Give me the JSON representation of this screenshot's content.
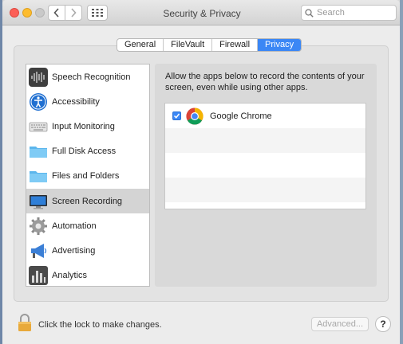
{
  "window": {
    "title": "Security & Privacy",
    "search_placeholder": "Search"
  },
  "tabs": [
    {
      "label": "General",
      "active": false
    },
    {
      "label": "FileVault",
      "active": false
    },
    {
      "label": "Firewall",
      "active": false
    },
    {
      "label": "Privacy",
      "active": true
    }
  ],
  "sidebar": {
    "items": [
      {
        "label": "Speech Recognition",
        "icon": "waveform-icon"
      },
      {
        "label": "Accessibility",
        "icon": "accessibility-icon"
      },
      {
        "label": "Input Monitoring",
        "icon": "keyboard-icon"
      },
      {
        "label": "Full Disk Access",
        "icon": "folder-icon"
      },
      {
        "label": "Files and Folders",
        "icon": "folder-icon"
      },
      {
        "label": "Screen Recording",
        "icon": "display-icon",
        "selected": true
      },
      {
        "label": "Automation",
        "icon": "gear-icon"
      },
      {
        "label": "Advertising",
        "icon": "megaphone-icon"
      },
      {
        "label": "Analytics",
        "icon": "bar-chart-icon"
      }
    ]
  },
  "content": {
    "instructions": "Allow the apps below to record the contents of your screen, even while using other apps.",
    "apps": [
      {
        "name": "Google Chrome",
        "checked": true,
        "icon": "chrome-icon"
      }
    ]
  },
  "footer": {
    "lock_text": "Click the lock to make changes.",
    "advanced_label": "Advanced...",
    "help_label": "?"
  },
  "colors": {
    "accent": "#3b87f5",
    "selected_row": "#d4d4d4"
  }
}
